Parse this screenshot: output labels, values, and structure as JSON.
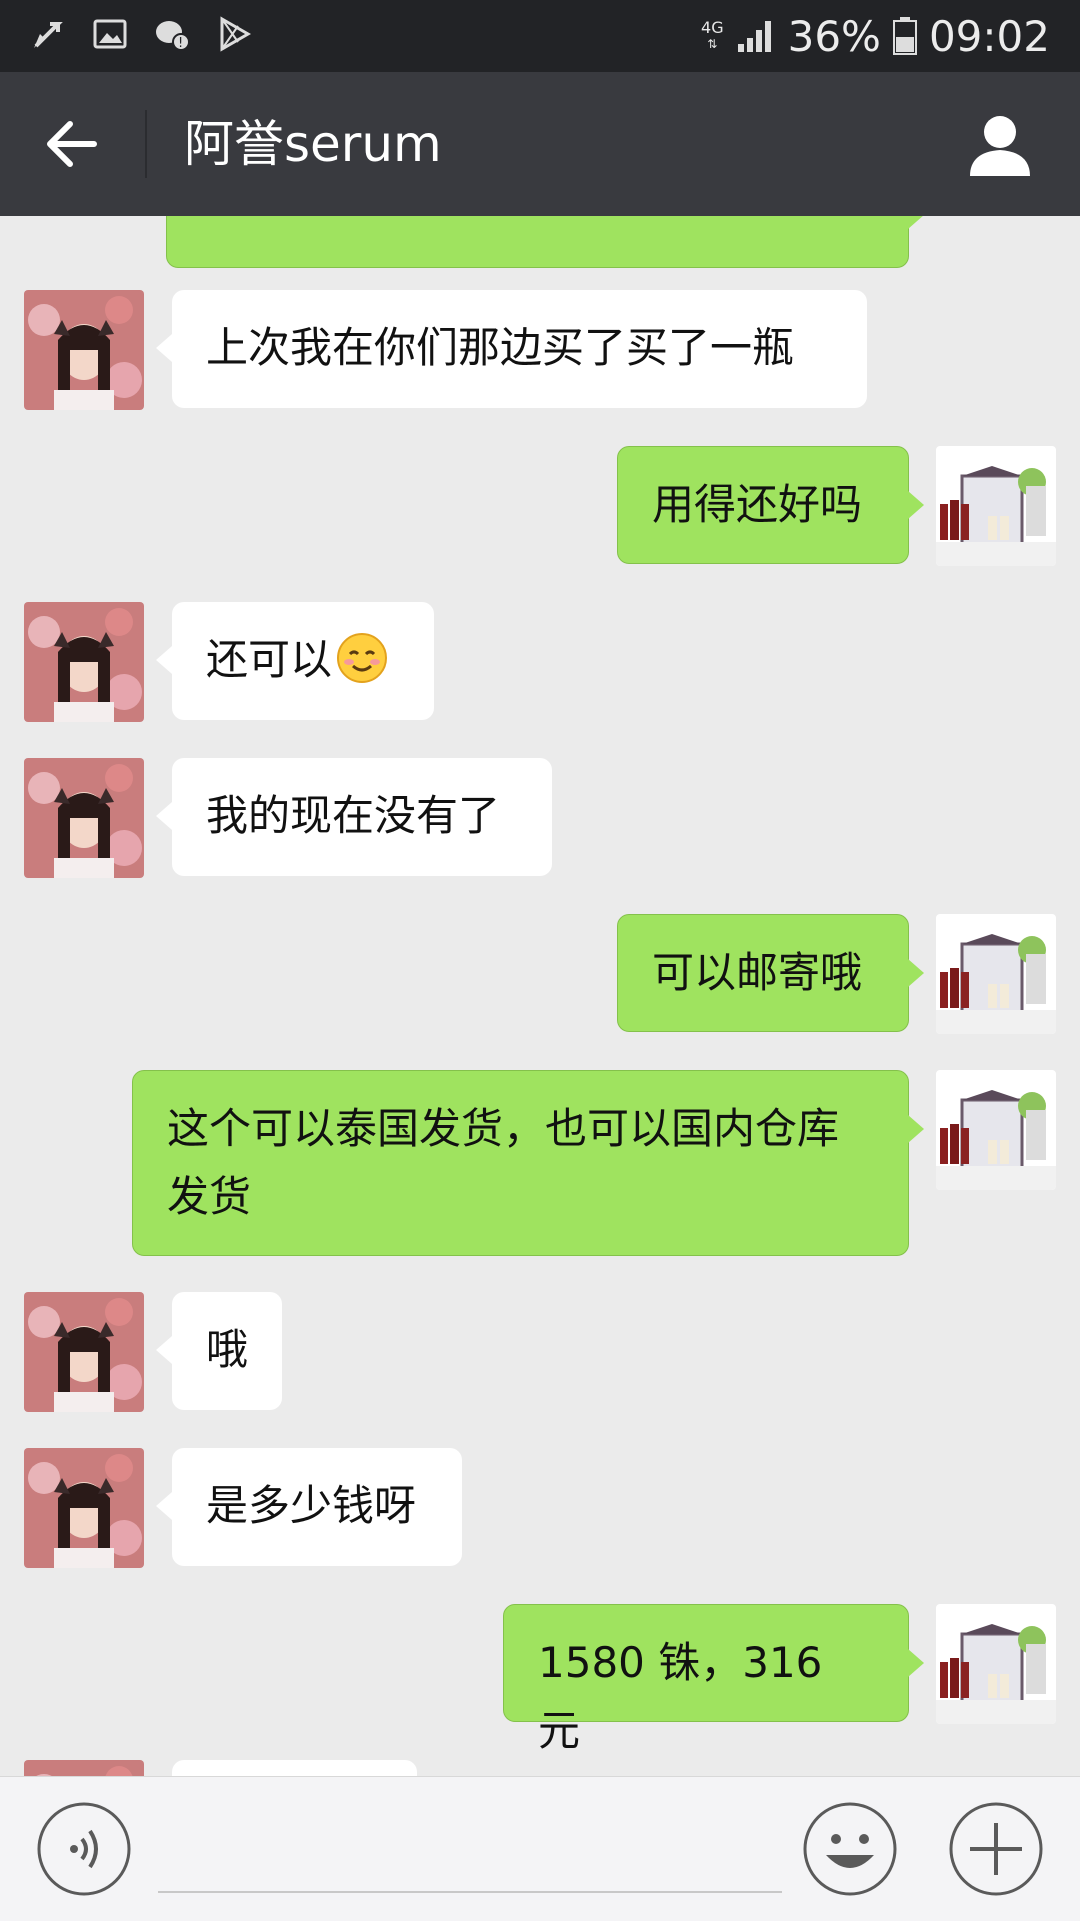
{
  "status_bar": {
    "network": "4G",
    "battery_percent": "36%",
    "time": "09:02",
    "icons": [
      "notification-arrow-icon",
      "image-icon",
      "wechat-alert-icon",
      "play-store-icon",
      "signal-icon",
      "battery-icon"
    ]
  },
  "header": {
    "title": "阿誉serum",
    "back_icon": "back-arrow-icon",
    "profile_icon": "person-icon",
    "background": "#393a3f"
  },
  "messages": [
    {
      "from": "contact",
      "text": "上次我在你们那边买了买了一瓶"
    },
    {
      "from": "me",
      "text": "用得还好吗"
    },
    {
      "from": "contact",
      "text": "还可以",
      "emoji": "smiling-face-emoji"
    },
    {
      "from": "contact",
      "text": "我的现在没有了"
    },
    {
      "from": "me",
      "text": "可以邮寄哦"
    },
    {
      "from": "me",
      "text": "这个可以泰国发货，也可以国内仓库",
      "text2": "发货"
    },
    {
      "from": "contact",
      "text": "哦"
    },
    {
      "from": "contact",
      "text": "是多少钱呀"
    },
    {
      "from": "me",
      "text": "1580 铢，316 元"
    }
  ],
  "input_bar": {
    "voice_icon": "voice-icon",
    "emoji_icon": "emoji-smile-icon",
    "add_icon": "plus-icon",
    "placeholder": ""
  },
  "colors": {
    "out_bubble": "#9fe35f",
    "in_bubble": "#ffffff",
    "chat_bg": "#ebebeb"
  }
}
